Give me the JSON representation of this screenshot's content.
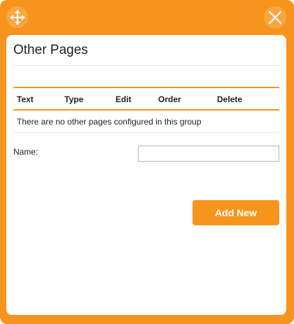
{
  "window": {
    "move_icon": "move-arrows-icon",
    "close_icon": "close-x-icon",
    "accent_color": "#f7941d"
  },
  "main": {
    "title": "Other Pages",
    "table": {
      "columns": [
        "Text",
        "Type",
        "Edit",
        "Order",
        "Delete"
      ],
      "empty_message": "There are no other pages configured in this group"
    },
    "form": {
      "name_label": "Name:",
      "name_value": "",
      "add_button_label": "Add New"
    }
  }
}
